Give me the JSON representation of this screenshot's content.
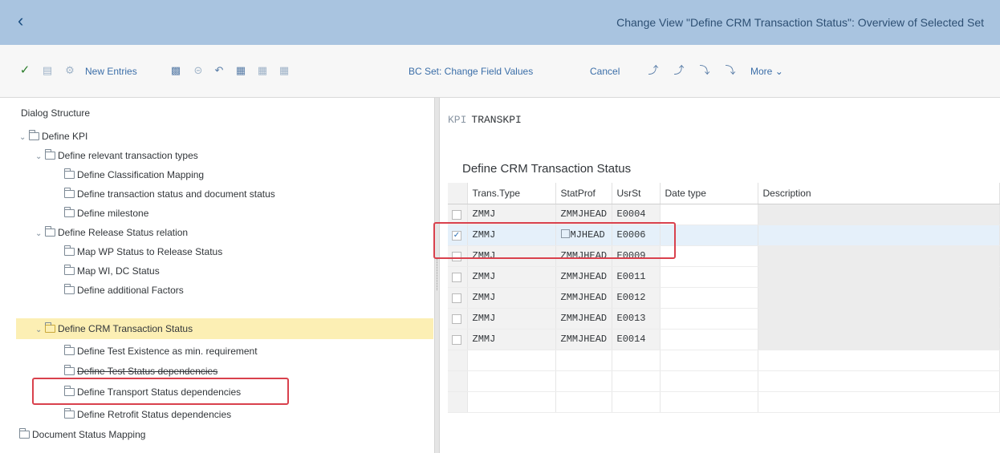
{
  "header": {
    "back_icon": "chevron-left-icon",
    "title": "Change View \"Define CRM Transaction Status\": Overview of Selected Set"
  },
  "toolbar": {
    "new_entries": "New Entries",
    "bc_set": "BC Set: Change Field Values",
    "cancel": "Cancel",
    "more": "More",
    "more_glyph": "⌄"
  },
  "left": {
    "header": "Dialog Structure",
    "items": [
      {
        "label": "Define KPI"
      },
      {
        "label": "Define relevant transaction types"
      },
      {
        "label": "Define Classification Mapping"
      },
      {
        "label": "Define transaction status and document status"
      },
      {
        "label": "Define milestone"
      },
      {
        "label": "Define Release Status relation"
      },
      {
        "label": "Map WP Status to Release Status"
      },
      {
        "label": "Map WI, DC Status"
      },
      {
        "label": "Define additional Factors"
      },
      {
        "label": "Define CRM Transaction Status"
      },
      {
        "label": "Define Test Existence as min. requirement"
      },
      {
        "label": "Define Test Status dependencies"
      },
      {
        "label": "Define Transport Status dependencies"
      },
      {
        "label": "Define Retrofit Status dependencies"
      },
      {
        "label": "Document Status Mapping"
      }
    ]
  },
  "right": {
    "kpi_label": "KPI",
    "kpi_value": "TRANSKPI",
    "section_title": "Define CRM Transaction Status",
    "columns": {
      "trans_type": "Trans.Type",
      "stat_prof": "StatProf",
      "usr_st": "UsrSt",
      "date_type": "Date type",
      "description": "Description"
    },
    "rows": [
      {
        "trans_type": "ZMMJ",
        "stat_prof": "ZMMJHEAD",
        "usr_st": "E0004",
        "selected": false
      },
      {
        "trans_type": "ZMMJ",
        "stat_prof": "MJHEAD",
        "usr_st": "E0006",
        "selected": true
      },
      {
        "trans_type": "ZMMJ",
        "stat_prof": "ZMMJHEAD",
        "usr_st": "E0009",
        "selected": false
      },
      {
        "trans_type": "ZMMJ",
        "stat_prof": "ZMMJHEAD",
        "usr_st": "E0011",
        "selected": false
      },
      {
        "trans_type": "ZMMJ",
        "stat_prof": "ZMMJHEAD",
        "usr_st": "E0012",
        "selected": false
      },
      {
        "trans_type": "ZMMJ",
        "stat_prof": "ZMMJHEAD",
        "usr_st": "E0013",
        "selected": false
      },
      {
        "trans_type": "ZMMJ",
        "stat_prof": "ZMMJHEAD",
        "usr_st": "E0014",
        "selected": false
      }
    ]
  },
  "colors": {
    "shell": "#a9c4e0",
    "highlight_row": "#fcefb4",
    "annotation_red": "#d9414d",
    "link_blue": "#3b6ea8"
  }
}
